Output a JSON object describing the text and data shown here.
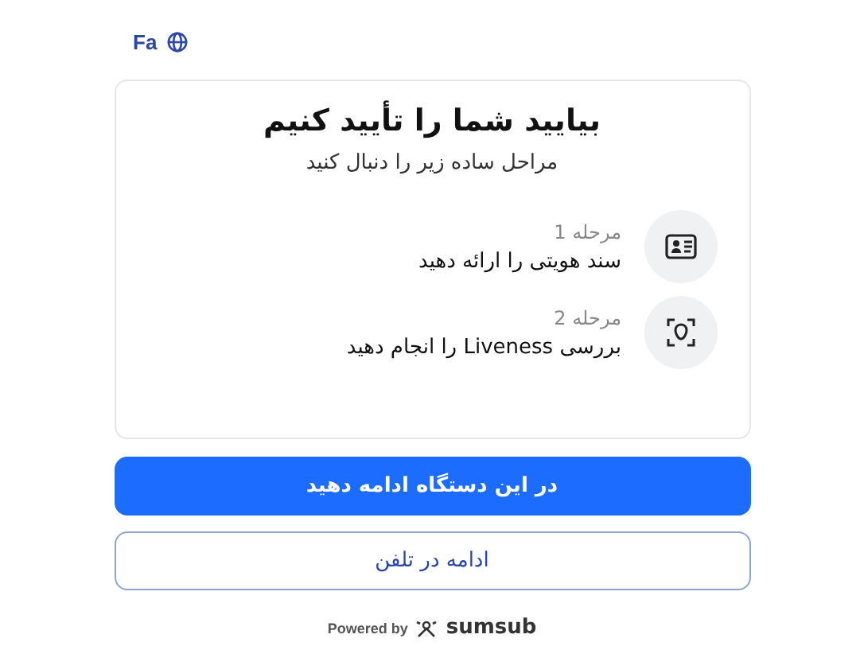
{
  "language": {
    "label": "Fa"
  },
  "card": {
    "title": "بیایید شما را تأیید کنیم",
    "subtitle": "مراحل ساده زیر را دنبال کنید",
    "steps": [
      {
        "kind": "document",
        "step": "مرحله 1",
        "label": "سند هویتی را ارائه دهید"
      },
      {
        "kind": "liveness",
        "step": "مرحله 2",
        "label": "بررسی Liveness را انجام دهید"
      }
    ]
  },
  "buttons": [
    {
      "kind": "primary",
      "label": "در این دستگاه ادامه دهید"
    },
    {
      "kind": "secondary",
      "label": "ادامه در تلفن"
    }
  ],
  "footer": {
    "powered_by": "Powered by",
    "brand": "sumsub"
  }
}
